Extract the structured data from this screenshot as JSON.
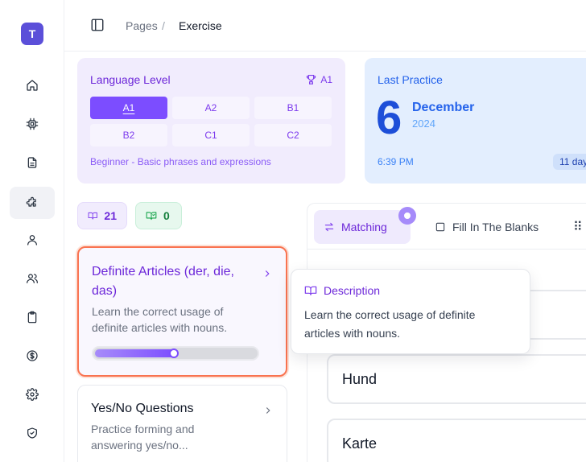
{
  "app": {
    "logo_letter": "T"
  },
  "breadcrumb": {
    "parent": "Pages",
    "separator": "/",
    "current": "Exercise"
  },
  "sidebar": {
    "items": [
      {
        "name": "home",
        "icon": "home-icon",
        "active": false
      },
      {
        "name": "chip",
        "icon": "chip-icon",
        "active": false
      },
      {
        "name": "document",
        "icon": "file-text-icon",
        "active": false
      },
      {
        "name": "puzzle",
        "icon": "puzzle-icon",
        "active": true
      },
      {
        "name": "user",
        "icon": "user-icon",
        "active": false
      },
      {
        "name": "users",
        "icon": "users-icon",
        "active": false
      },
      {
        "name": "clipboard",
        "icon": "clipboard-icon",
        "active": false
      },
      {
        "name": "billing",
        "icon": "dollar-circle-icon",
        "active": false
      },
      {
        "name": "settings",
        "icon": "gear-icon",
        "active": false
      },
      {
        "name": "security",
        "icon": "shield-check-icon",
        "active": false
      }
    ]
  },
  "language_level": {
    "title": "Language Level",
    "current_badge": "A1",
    "levels": [
      "A1",
      "A2",
      "B1",
      "B2",
      "C1",
      "C2"
    ],
    "selected": "A1",
    "description": "Beginner - Basic phrases and expressions"
  },
  "last_practice": {
    "title": "Last Practice",
    "day": "6",
    "month": "December",
    "year": "2024",
    "time": "6:39 PM",
    "days_label": "11 day"
  },
  "counters": {
    "books": "21",
    "completed": "0"
  },
  "exercises": [
    {
      "title": "Definite Articles (der, die, das)",
      "description": "Learn the correct usage of definite articles with nouns.",
      "progress": 0.5,
      "selected": true
    },
    {
      "title": "Yes/No Questions",
      "description": "Practice forming and answering yes/no...",
      "selected": false
    }
  ],
  "tabs": [
    {
      "label": "Matching",
      "icon": "arrows-swap-icon",
      "active": true
    },
    {
      "label": "Fill In The Blanks",
      "icon": "checkbox-icon",
      "active": false
    }
  ],
  "tooltip": {
    "title": "Description",
    "body": "Learn the correct usage of definite articles with nouns."
  },
  "words": [
    "Hund",
    "Karte"
  ],
  "colors": {
    "accent": "#7c4dff",
    "selected_border": "#f97350",
    "level_bg": "#f1ecfd",
    "practice_bg": "#e3eefe"
  }
}
